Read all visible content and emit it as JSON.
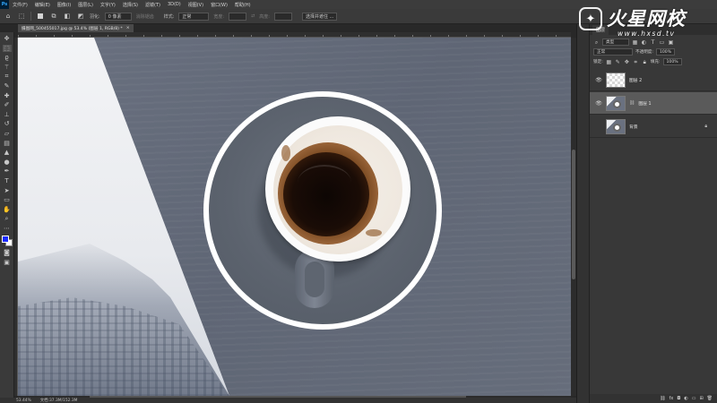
{
  "menubar": {
    "logo": "Ps",
    "items": [
      "文件(F)",
      "编辑(E)",
      "图像(I)",
      "图层(L)",
      "文字(Y)",
      "选择(S)",
      "滤镜(T)",
      "3D(D)",
      "视图(V)",
      "窗口(W)",
      "帮助(H)"
    ]
  },
  "options": {
    "feather_label": "羽化:",
    "feather_value": "0 像素",
    "antialias_label": "消除锯齿",
    "style_label": "样式:",
    "style_value": "正常",
    "width_label": "宽度:",
    "height_label": "高度:",
    "select_mask_label": "选择并遮住 ..."
  },
  "document": {
    "tab_title": "摄图网_500455017.jpg @ 53.4% (图层 1, RGB/8) *",
    "tab_close": "×"
  },
  "status": {
    "zoom": "53.44%",
    "doc_info": "文档:37.3M/152.3M"
  },
  "panel": {
    "tab_label": "图层",
    "kind_label": "类型",
    "blend_mode": "正常",
    "opacity_label": "不透明度:",
    "opacity_value": "100%",
    "lock_label": "锁定:",
    "fill_label": "填充:",
    "fill_value": "100%",
    "layers": [
      {
        "name": "图层 2",
        "visible": true,
        "selected": false
      },
      {
        "name": "图层 1",
        "visible": true,
        "selected": true
      },
      {
        "name": "背景",
        "visible": false,
        "selected": false,
        "locked": true
      }
    ]
  },
  "watermark": {
    "text": "火星网校",
    "url": "www.hxsd.tv"
  },
  "colors": {
    "foreground": "#1a2bff",
    "background": "#ffffff",
    "accent": "#31a8ff"
  },
  "icons": {
    "tools": [
      "move-icon",
      "marquee-icon",
      "lasso-icon",
      "magic-wand-icon",
      "crop-icon",
      "eyedropper-icon",
      "healing-icon",
      "brush-icon",
      "stamp-icon",
      "history-brush-icon",
      "eraser-icon",
      "gradient-icon",
      "blur-icon",
      "dodge-icon",
      "pen-icon",
      "type-icon",
      "path-select-icon",
      "shape-icon",
      "hand-icon",
      "zoom-icon"
    ]
  }
}
